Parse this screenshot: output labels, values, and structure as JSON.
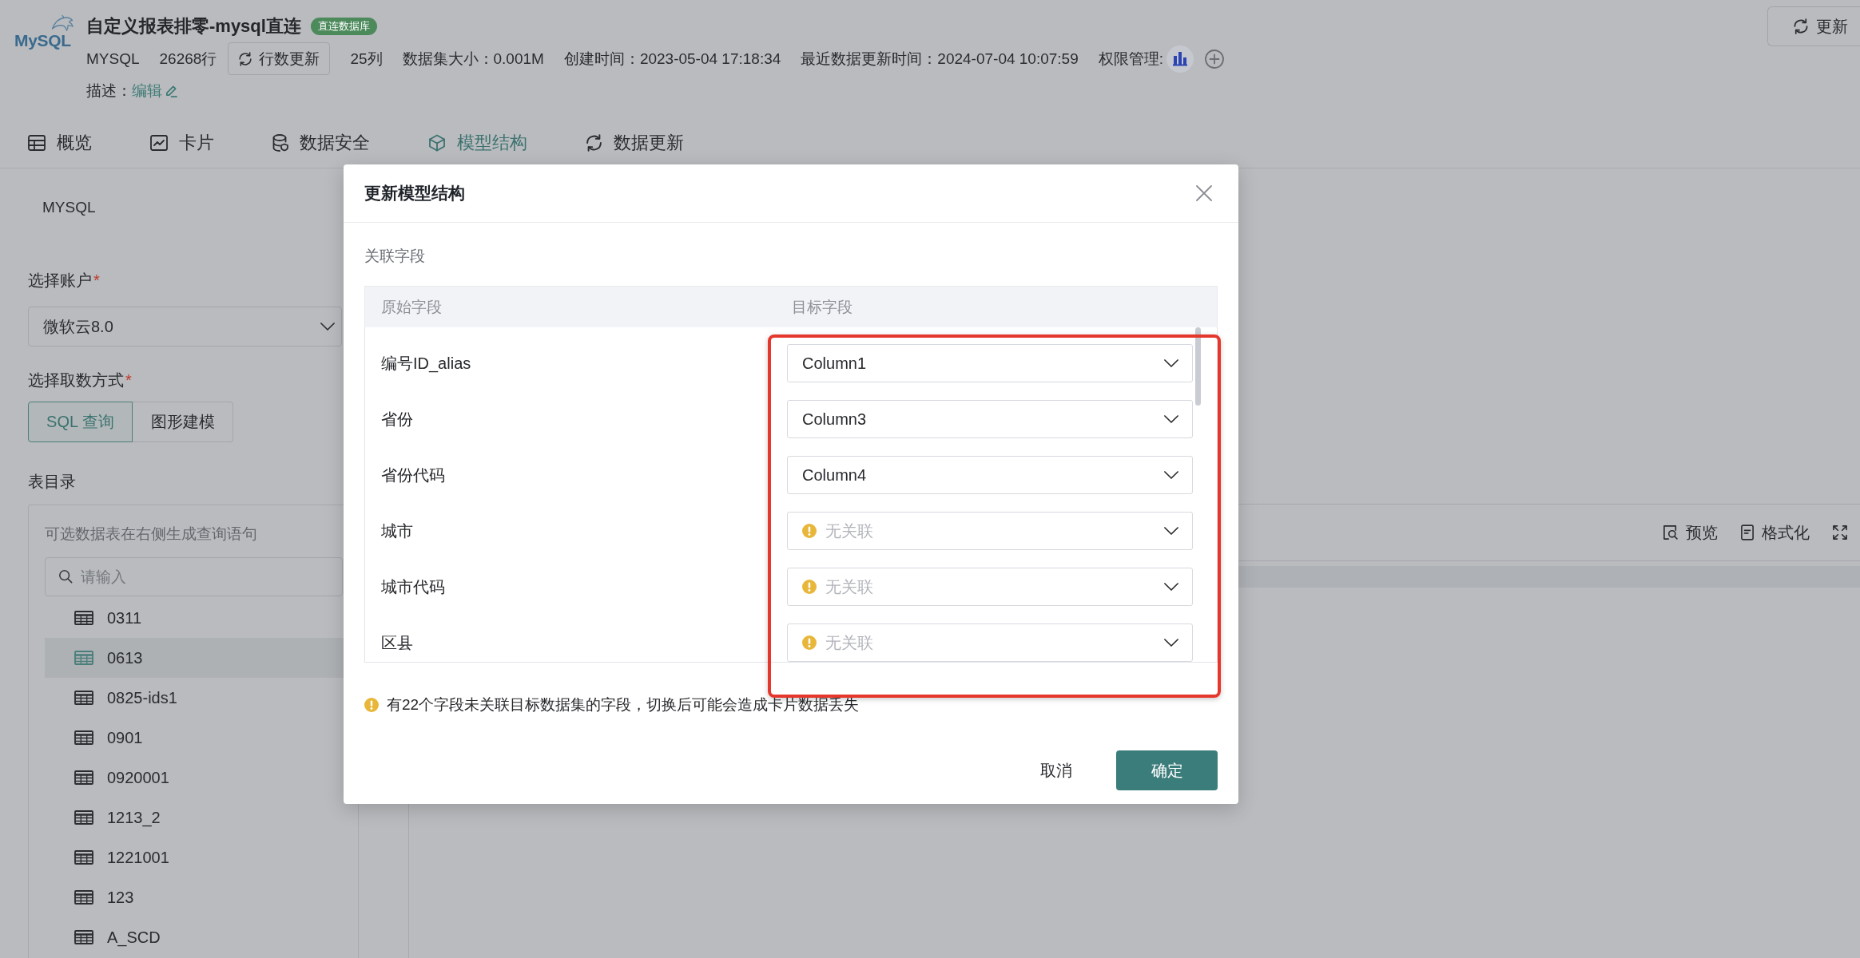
{
  "header": {
    "logo_text": "MySQL",
    "title": "自定义报表排零-mysql直连",
    "badge": "直连数据库",
    "engine": "MYSQL",
    "row_count": "26268行",
    "row_refresh_button": "行数更新",
    "column_count": "25列",
    "dataset_size": "数据集大小：0.001M",
    "created_time": "创建时间：2023-05-04 17:18:34",
    "updated_time": "最近数据更新时间：2024-07-04 10:07:59",
    "permission_label": "权限管理:",
    "description_label": "描述：",
    "edit_link": "编辑",
    "update_button": "更新"
  },
  "tabs": [
    {
      "label": "概览",
      "selected": false
    },
    {
      "label": "卡片",
      "selected": false
    },
    {
      "label": "数据安全",
      "selected": false
    },
    {
      "label": "模型结构",
      "selected": true
    },
    {
      "label": "数据更新",
      "selected": false
    }
  ],
  "source_panel": {
    "source_type": "MYSQL",
    "account": {
      "label": "选择账户",
      "required_mark": "*",
      "value": "微软云8.0"
    },
    "fetch_mode": {
      "label": "选择取数方式",
      "required_mark": "*",
      "options": [
        {
          "label": "SQL 查询",
          "selected": true
        },
        {
          "label": "图形建模",
          "selected": false
        }
      ]
    },
    "catalog": {
      "label": "表目录",
      "hint": "可选数据表在右侧生成查询语句",
      "search": {
        "placeholder": "请输入"
      },
      "tables": [
        {
          "name": "0311",
          "selected": false
        },
        {
          "name": "0613",
          "selected": true
        },
        {
          "name": "0825-ids1",
          "selected": false
        },
        {
          "name": "0901",
          "selected": false
        },
        {
          "name": "0920001",
          "selected": false
        },
        {
          "name": "1213_2",
          "selected": false
        },
        {
          "name": "1221001",
          "selected": false
        },
        {
          "name": "123",
          "selected": false
        },
        {
          "name": "A_SCD",
          "selected": false
        }
      ]
    }
  },
  "editor_toolbar": [
    {
      "label": "预览"
    },
    {
      "label": "格式化"
    }
  ],
  "dialog": {
    "title": "更新模型结构",
    "section_label": "关联字段",
    "columns": [
      "原始字段",
      "目标字段"
    ],
    "rows": [
      {
        "source": "编号ID_alias",
        "value": "Column1",
        "warning": false
      },
      {
        "source": "省份",
        "value": "Column3",
        "warning": false
      },
      {
        "source": "省份代码",
        "value": "Column4",
        "warning": false
      },
      {
        "source": "城市",
        "placeholder": "无关联",
        "warning": true
      },
      {
        "source": "城市代码",
        "placeholder": "无关联",
        "warning": true
      },
      {
        "source": "区县",
        "placeholder": "无关联",
        "warning": true
      }
    ],
    "warning": "有22个字段未关联目标数据集的字段，切换后可能会造成卡片数据丢失",
    "buttons": [
      {
        "label": "取消",
        "kind": "secondary"
      },
      {
        "label": "确定",
        "kind": "primary"
      }
    ]
  }
}
